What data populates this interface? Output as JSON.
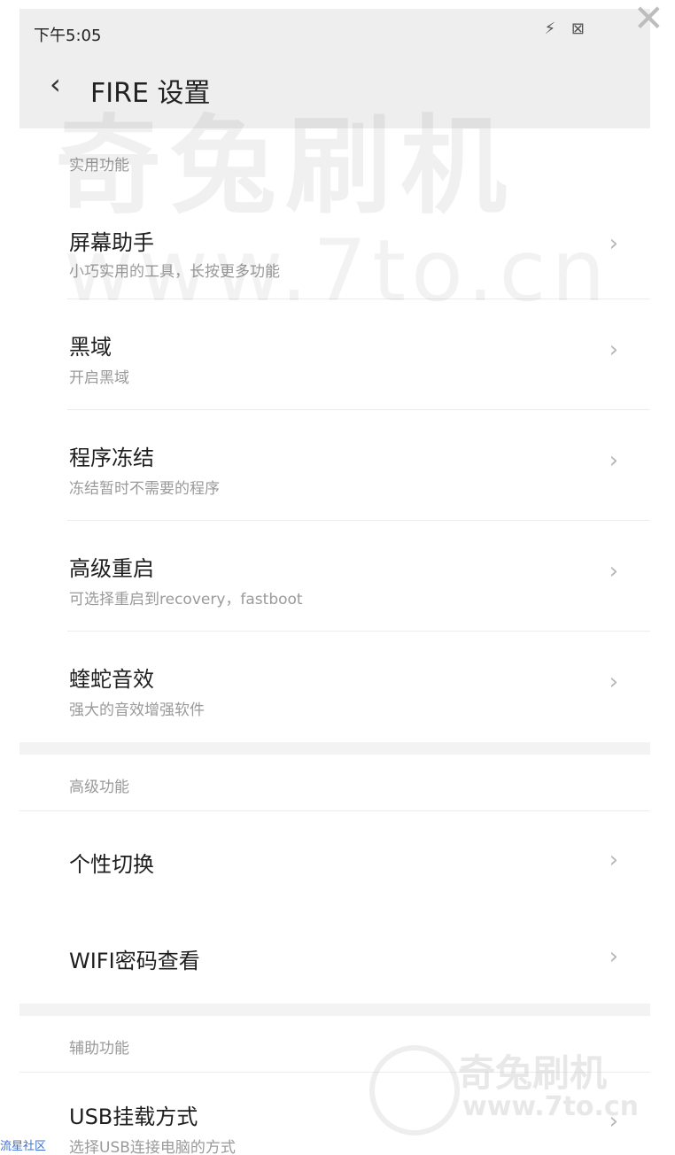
{
  "status_bar": {
    "time": "下午5:05",
    "icons": "⚡ ⊠"
  },
  "header": {
    "back_icon": "‹",
    "title": "FIRE 设置"
  },
  "watermark": {
    "line1": "奇兔刷机",
    "line2": "www.7to.cn"
  },
  "sections": [
    {
      "header": "实用功能",
      "items": [
        {
          "title": "屏幕助手",
          "subtitle": "小巧实用的工具，长按更多功能"
        },
        {
          "title": "黑域",
          "subtitle": "开启黑域"
        },
        {
          "title": "程序冻结",
          "subtitle": "冻结暂时不需要的程序"
        },
        {
          "title": "高级重启",
          "subtitle": "可选择重启到recovery，fastboot"
        },
        {
          "title": "蝰蛇音效",
          "subtitle": "强大的音效增强软件"
        }
      ]
    },
    {
      "header": "高级功能",
      "items": [
        {
          "title": "个性切换"
        },
        {
          "title": "WIFI密码查看"
        }
      ]
    },
    {
      "header": "辅助功能",
      "items": [
        {
          "title": "USB挂载方式",
          "subtitle": "选择USB连接电脑的方式"
        }
      ]
    }
  ],
  "chevron": "›",
  "close_icon": "✕",
  "footer_tag": "流星社区",
  "logo_watermark": {
    "text1": "奇兔刷机",
    "text2": "www.7to.cn"
  }
}
